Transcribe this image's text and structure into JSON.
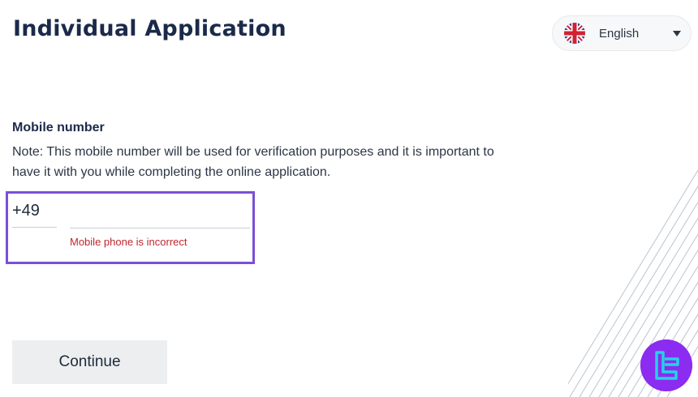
{
  "header": {
    "title": "Individual Application"
  },
  "language": {
    "selected": "English",
    "flag_icon": "uk-flag-icon",
    "chevron_icon": "chevron-down-icon"
  },
  "form": {
    "label": "Mobile number",
    "note": "Note: This mobile number will be used for verification purposes and it is important to have it with you while completing the online application.",
    "country_code": "+49",
    "phone_value": "",
    "error": "Mobile phone is incorrect"
  },
  "actions": {
    "continue_label": "Continue"
  },
  "colors": {
    "title": "#1b2a4a",
    "error": "#c0262d",
    "focus_outline": "#7b4fd6",
    "button_bg": "#eceef0",
    "logo_bg": "#8b2cf0",
    "logo_glyph": "#22d3e6"
  },
  "icons": {
    "logo": "brand-logo-icon",
    "decor": "diagonal-lines-decoration"
  }
}
